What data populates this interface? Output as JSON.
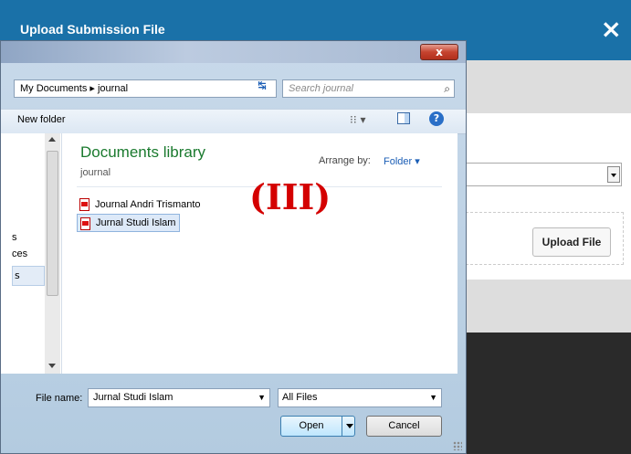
{
  "web": {
    "title": "Upload Submission File",
    "close_icon": "×",
    "upload_button": "Upload File"
  },
  "dialog": {
    "close_glyph": "x",
    "address": "My Documents ▸ journal",
    "refresh_glyph": "↹",
    "search_placeholder": "Search journal",
    "search_icon": "⌕",
    "new_folder": "New folder",
    "view_glyph": "⁝⁝ ▾",
    "help_glyph": "?",
    "nav_items": [
      "s",
      "ces"
    ],
    "nav_selected": "s",
    "library_title": "Documents library",
    "library_subtitle": "journal",
    "arrange_label": "Arrange by:",
    "arrange_value": "Folder ▾",
    "files": [
      "Journal Andri Trismanto",
      "Jurnal Studi Islam"
    ],
    "annotation": "(III)",
    "file_name_label": "File name:",
    "file_name_value": "Jurnal Studi Islam",
    "file_type": "All Files",
    "open_label": "Open",
    "cancel_label": "Cancel"
  }
}
